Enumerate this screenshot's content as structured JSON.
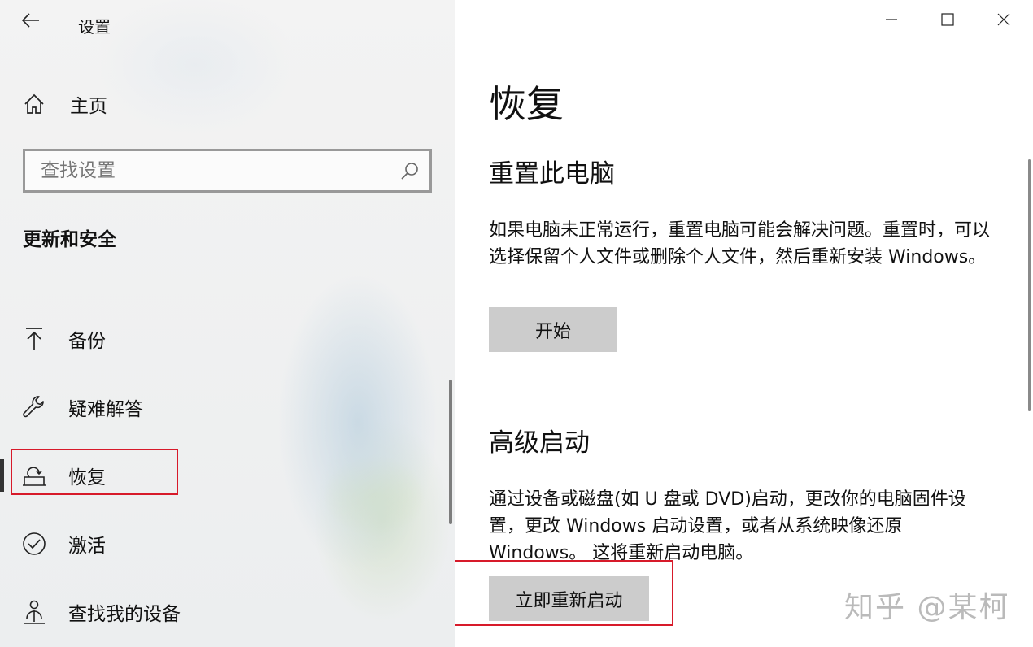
{
  "window": {
    "title": "设置",
    "controls": {
      "minimize": "minimize-icon",
      "maximize": "maximize-icon",
      "close": "close-icon"
    }
  },
  "sidebar": {
    "home_label": "主页",
    "search": {
      "placeholder": "查找设置",
      "value": ""
    },
    "section_title": "更新和安全",
    "items": [
      {
        "label": "备份",
        "icon": "backup-arrow-icon"
      },
      {
        "label": "疑难解答",
        "icon": "wrench-icon"
      },
      {
        "label": "恢复",
        "icon": "recovery-icon",
        "selected": true
      },
      {
        "label": "激活",
        "icon": "check-circle-icon"
      },
      {
        "label": "查找我的设备",
        "icon": "person-location-icon"
      }
    ]
  },
  "main": {
    "title": "恢复",
    "reset": {
      "title": "重置此电脑",
      "description": "如果电脑未正常运行，重置电脑可能会解决问题。重置时，可以选择保留个人文件或删除个人文件，然后重新安装 Windows。",
      "button": "开始"
    },
    "advanced": {
      "title": "高级启动",
      "description": "通过设备或磁盘(如 U 盘或 DVD)启动，更改你的电脑固件设置，更改 Windows 启动设置，或者从系统映像还原 Windows。 这将重新启动电脑。",
      "button": "立即重新启动"
    }
  },
  "watermark": "知乎 @某柯",
  "colors": {
    "highlight": "#d71a2a",
    "button": "#cccccc",
    "accent_bar": "#333333"
  }
}
